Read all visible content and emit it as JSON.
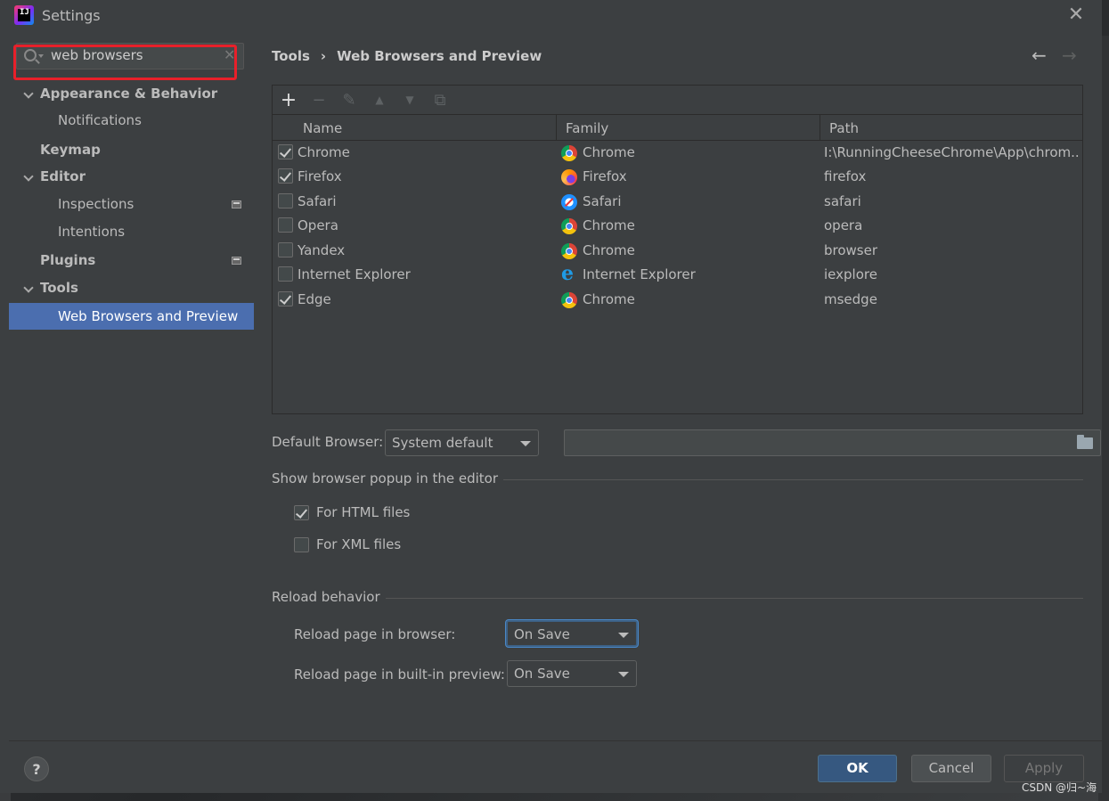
{
  "window": {
    "title": "Settings",
    "close_label": "✕"
  },
  "search": {
    "value": "web browsers",
    "clear": "✕"
  },
  "sidebar": {
    "items": [
      {
        "label": "Appearance & Behavior"
      },
      {
        "label": "Notifications"
      },
      {
        "label": "Keymap"
      },
      {
        "label": "Editor"
      },
      {
        "label": "Inspections"
      },
      {
        "label": "Intentions"
      },
      {
        "label": "Plugins"
      },
      {
        "label": "Tools"
      },
      {
        "label": "Web Browsers and Preview"
      }
    ]
  },
  "breadcrumb": {
    "parent": "Tools",
    "separator": "›",
    "current": "Web Browsers and Preview"
  },
  "nav": {
    "back": "←",
    "forward": "→"
  },
  "toolbar": {
    "add": "+",
    "remove": "−",
    "edit": "✎",
    "up": "▲",
    "down": "▼",
    "copy": "⧉"
  },
  "table": {
    "headers": {
      "name": "Name",
      "family": "Family",
      "path": "Path"
    },
    "rows": [
      {
        "checked": true,
        "name": "Chrome",
        "family": "Chrome",
        "family_icon": "chrome-icon",
        "path": "I:\\RunningCheeseChrome\\App\\chrom..."
      },
      {
        "checked": true,
        "name": "Firefox",
        "family": "Firefox",
        "family_icon": "firefox-icon",
        "path": "firefox"
      },
      {
        "checked": false,
        "name": "Safari",
        "family": "Safari",
        "family_icon": "safari-icon",
        "path": "safari"
      },
      {
        "checked": false,
        "name": "Opera",
        "family": "Chrome",
        "family_icon": "chrome-icon",
        "path": "opera"
      },
      {
        "checked": false,
        "name": "Yandex",
        "family": "Chrome",
        "family_icon": "chrome-icon",
        "path": "browser"
      },
      {
        "checked": false,
        "name": "Internet Explorer",
        "family": "Internet Explorer",
        "family_icon": "ie-icon",
        "path": "iexplore"
      },
      {
        "checked": true,
        "name": "Edge",
        "family": "Chrome",
        "family_icon": "chrome-icon",
        "path": "msedge"
      }
    ]
  },
  "default_browser": {
    "label": "Default Browser:",
    "value": "System default",
    "path_value": ""
  },
  "popup_section": {
    "title": "Show browser popup in the editor",
    "html": {
      "label": "For HTML files",
      "checked": true
    },
    "xml": {
      "label": "For XML files",
      "checked": false
    }
  },
  "reload_section": {
    "title": "Reload behavior",
    "browser": {
      "label": "Reload page in browser:",
      "value": "On Save"
    },
    "preview": {
      "label": "Reload page in built-in preview:",
      "value": "On Save"
    }
  },
  "footer": {
    "help": "?",
    "ok": "OK",
    "cancel": "Cancel",
    "apply": "Apply"
  },
  "watermark": "CSDN @归~海",
  "colors": {
    "selection": "#4b6eaf",
    "primary_button": "#365880",
    "highlight": "#e8202a"
  }
}
